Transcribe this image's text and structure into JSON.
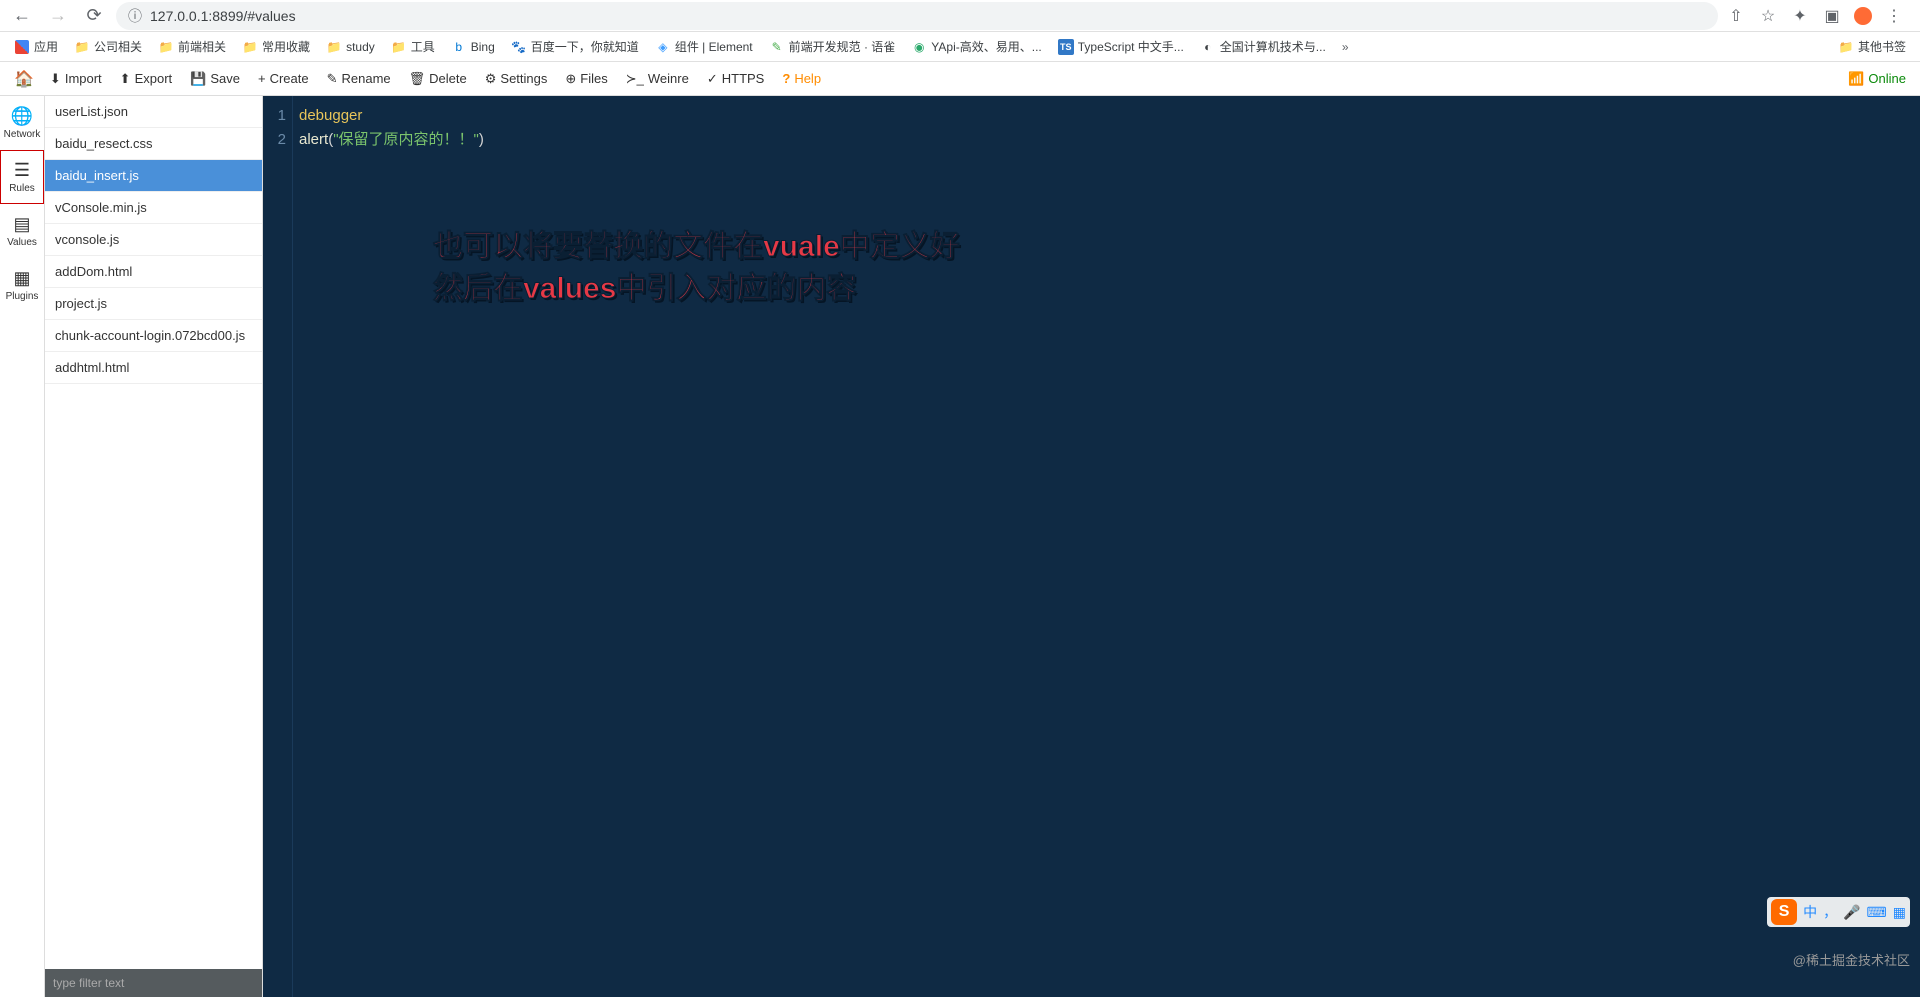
{
  "browser": {
    "url": "127.0.0.1:8899/#values"
  },
  "bookmarks": {
    "apps": "应用",
    "items": [
      "公司相关",
      "前端相关",
      "常用收藏",
      "study",
      "工具",
      "Bing",
      "百度一下，你就知道",
      "组件 | Element",
      "前端开发规范 · 语雀",
      "YApi-高效、易用、...",
      "TypeScript 中文手...",
      "全国计算机技术与..."
    ],
    "other": "其他书签"
  },
  "toolbar": {
    "import": "Import",
    "export": "Export",
    "save": "Save",
    "create": "Create",
    "rename": "Rename",
    "delete": "Delete",
    "settings": "Settings",
    "files": "Files",
    "weinre": "Weinre",
    "https": "HTTPS",
    "help": "Help",
    "online": "Online"
  },
  "sidebar": {
    "network": "Network",
    "rules": "Rules",
    "values": "Values",
    "plugins": "Plugins"
  },
  "files": [
    "userList.json",
    "baidu_resect.css",
    "baidu_insert.js",
    "vConsole.min.js",
    "vconsole.js",
    "addDom.html",
    "project.js",
    "chunk-account-login.072bcd00.js",
    "addhtml.html"
  ],
  "selected_file_index": 2,
  "filter_placeholder": "type filter text",
  "code": {
    "line1": "debugger",
    "line2_fn": "alert",
    "line2_str": "\"保留了原内容的！！\""
  },
  "annotation": {
    "l1": "也可以将要替换的文件在vuale中定义好",
    "l2": "然后在values中引入对应的内容"
  },
  "ime": {
    "s": "S",
    "lang": "中"
  },
  "watermark": "@稀土掘金技术社区"
}
